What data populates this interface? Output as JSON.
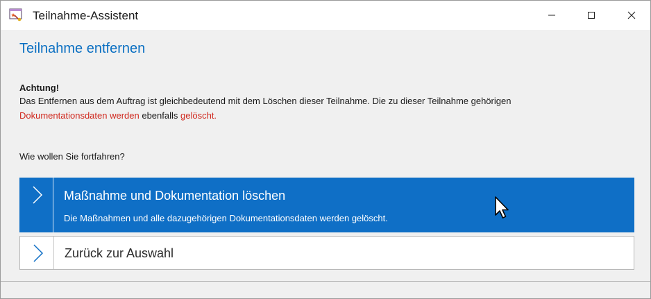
{
  "window": {
    "title": "Teilnahme-Assistent",
    "controls": {
      "minimize_icon": "minimize-icon",
      "maximize_icon": "maximize-icon",
      "close_icon": "close-icon"
    }
  },
  "page": {
    "heading": "Teilnahme entfernen",
    "warning": {
      "title": "Achtung!",
      "line1": "Das Entfernen aus dem Auftrag ist gleichbedeutend mit dem Löschen dieser Teilnahme. Die zu dieser Teilnahme gehörigen",
      "line2_red1": "Dokumentationsdaten werden",
      "line2_plain": " ebenfalls ",
      "line2_red2": "gelöscht."
    },
    "question": "Wie wollen Sie fortfahren?",
    "options": [
      {
        "title": "Maßnahme und Dokumentation löschen",
        "description": "Die Maßnahmen und alle dazugehörigen Dokumentationsdaten werden gelöscht.",
        "selected": true
      },
      {
        "title": "Zurück zur Auswahl",
        "selected": false
      }
    ]
  },
  "colors": {
    "accent": "#0f6fc6",
    "heading": "#0a6fc2",
    "warning_red": "#d0281e"
  }
}
